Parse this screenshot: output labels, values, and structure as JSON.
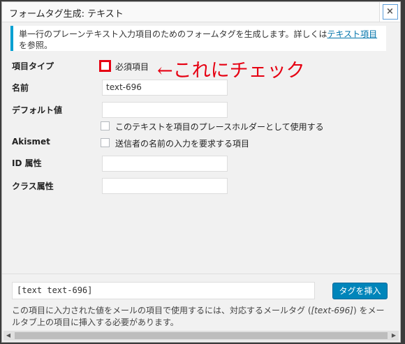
{
  "dialog": {
    "title": "フォームタグ生成: テキスト",
    "close_icon": "×"
  },
  "notice": {
    "text": "単一行のプレーンテキスト入力項目のためのフォームタグを生成します。詳しくは",
    "link": "テキスト項目",
    "suffix": "を参照。"
  },
  "fields": {
    "type_label": "項目タイプ",
    "required_label": "必須項目",
    "annotation": "←これにチェック",
    "name_label": "名前",
    "name_value": "text-696",
    "default_label": "デフォルト値",
    "default_value": "",
    "placeholder_option": "このテキストを項目のプレースホルダーとして使用する",
    "akismet_label": "Akismet",
    "akismet_option": "送信者の名前の入力を要求する項目",
    "id_label": "ID 属性",
    "id_value": "",
    "class_label": "クラス属性",
    "class_value": ""
  },
  "footer": {
    "tag_text": "[text text-696]",
    "insert_button": "タグを挿入",
    "note_before": "この項目に入力された値をメールの項目で使用するには、対応するメールタグ (",
    "note_tag": "[text-696]",
    "note_after": ") をメールタブ上の項目に挿入する必要があります。"
  },
  "colors": {
    "accent": "#0085ba",
    "annotation": "#e60012",
    "notice_border": "#00a0d2"
  },
  "icons": {
    "close": "close-icon",
    "scroll_left": "scroll-left-icon",
    "scroll_right": "scroll-right-icon"
  }
}
